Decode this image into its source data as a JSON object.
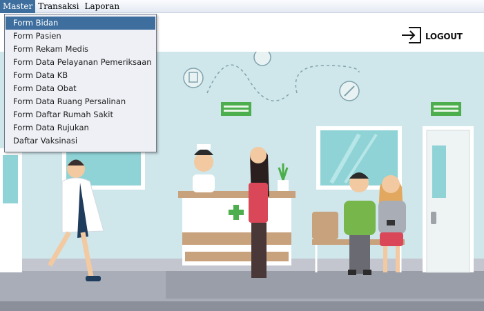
{
  "menubar": {
    "items": [
      {
        "label": "Master",
        "active": true
      },
      {
        "label": "Transaksi",
        "active": false
      },
      {
        "label": "Laporan",
        "active": false
      }
    ]
  },
  "dropdown": {
    "items": [
      {
        "label": "Form Bidan",
        "selected": true
      },
      {
        "label": "Form Pasien"
      },
      {
        "label": "Form Rekam Medis"
      },
      {
        "label": "Form Data Pelayanan Pemeriksaan"
      },
      {
        "label": "Form Data KB"
      },
      {
        "label": "Form Data Obat"
      },
      {
        "label": "Form Data Ruang Persalinan"
      },
      {
        "label": "Form Daftar Rumah Sakit"
      },
      {
        "label": "Form Data Rujukan"
      },
      {
        "label": "Daftar Vaksinasi"
      }
    ]
  },
  "header": {
    "logout_label": "LOGOUT",
    "logout_icon": "logout-icon"
  },
  "colors": {
    "menu_highlight": "#3d6e9e",
    "wall": "#cfe6ea",
    "floor": "#a9adb7",
    "cross_green": "#4cae4c"
  }
}
